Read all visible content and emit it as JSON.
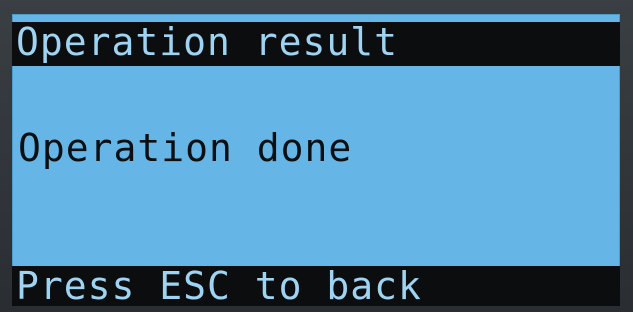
{
  "screen": {
    "title": "Operation result",
    "message": "Operation done",
    "footer": "Press ESC to back"
  },
  "colors": {
    "lcd_background": "#65b6e6",
    "bar_background": "#0b0d0f",
    "bar_text": "#9fd3f2",
    "text": "#0b0f12"
  }
}
